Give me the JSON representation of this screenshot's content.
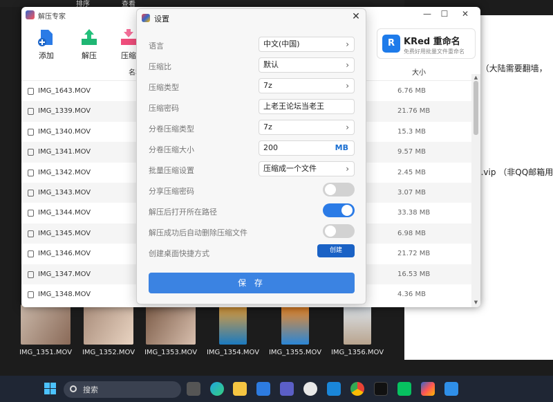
{
  "bg_toolbar": {
    "sort_label": "排序",
    "view_label": "查看"
  },
  "right_doc": {
    "line1": "p（大陆需要翻墙，",
    "line2": "g.vip （非QQ邮箱用"
  },
  "thumbnails": [
    "IMG_1351.MOV",
    "IMG_1352.MOV",
    "IMG_1353.MOV",
    "IMG_1354.MOV",
    "IMG_1355.MOV",
    "IMG_1356.MOV"
  ],
  "app": {
    "title": "解压专家",
    "toolbar": {
      "add": "添加",
      "extract": "解压",
      "compress": "压缩"
    },
    "ad": {
      "title": "KRed 重命名",
      "subtitle": "免费好用批量文件重命名"
    },
    "columns": {
      "name": "名称",
      "size": "大小"
    },
    "files": [
      {
        "name": "IMG_1643.MOV",
        "size": "6.76 MB"
      },
      {
        "name": "IMG_1339.MOV",
        "size": "21.76 MB"
      },
      {
        "name": "IMG_1340.MOV",
        "size": "15.3 MB"
      },
      {
        "name": "IMG_1341.MOV",
        "size": "9.57 MB"
      },
      {
        "name": "IMG_1342.MOV",
        "size": "2.45 MB"
      },
      {
        "name": "IMG_1343.MOV",
        "size": "3.07 MB"
      },
      {
        "name": "IMG_1344.MOV",
        "size": "33.38 MB"
      },
      {
        "name": "IMG_1345.MOV",
        "size": "6.98 MB"
      },
      {
        "name": "IMG_1346.MOV",
        "size": "21.72 MB"
      },
      {
        "name": "IMG_1347.MOV",
        "size": "16.53 MB"
      },
      {
        "name": "IMG_1348.MOV",
        "size": "4.36 MB"
      }
    ]
  },
  "dialog": {
    "title": "设置",
    "language": {
      "label": "语言",
      "value": "中文(中国)"
    },
    "ratio": {
      "label": "压缩比",
      "value": "默认"
    },
    "type": {
      "label": "压缩类型",
      "value": "7z"
    },
    "password": {
      "label": "压缩密码",
      "value": "上老王论坛当老王"
    },
    "split_type": {
      "label": "分卷压缩类型",
      "value": "7z"
    },
    "split_size": {
      "label": "分卷压缩大小",
      "value": "200",
      "unit": "MB"
    },
    "batch": {
      "label": "批量压缩设置",
      "value": "压缩成一个文件"
    },
    "share_pwd": {
      "label": "分享压缩密码",
      "on": false
    },
    "open_path": {
      "label": "解压后打开所在路径",
      "on": true
    },
    "auto_delete": {
      "label": "解压成功后自动删除压缩文件",
      "on": false
    },
    "shortcut": {
      "label": "创建桌面快捷方式",
      "button": "创建"
    },
    "save": "保 存"
  },
  "taskbar": {
    "search_label": "搜索"
  },
  "colors": {
    "accent": "#2b7be6",
    "taskbar": "#1f2634"
  }
}
